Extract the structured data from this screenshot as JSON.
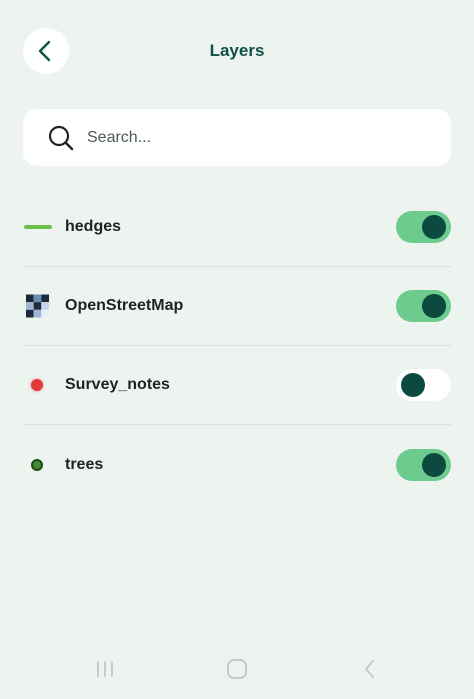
{
  "header": {
    "title": "Layers",
    "back_icon": "chevron-left-icon"
  },
  "search": {
    "placeholder": "Search...",
    "value": "",
    "icon": "search-icon"
  },
  "layers": [
    {
      "name": "hedges",
      "icon": "line-symbol-icon",
      "visible": true,
      "color": "#6CBF4B"
    },
    {
      "name": "OpenStreetMap",
      "icon": "raster-layer-icon",
      "visible": true
    },
    {
      "name": "Survey_notes",
      "icon": "point-symbol-icon",
      "visible": false,
      "color": "#E03A3A"
    },
    {
      "name": "trees",
      "icon": "point-symbol-icon",
      "visible": true,
      "color": "#3E8A2E"
    }
  ],
  "colors": {
    "background": "#EDF4F0",
    "accent": "#0E5146",
    "toggle_on": "#6DCB8E",
    "toggle_knob": "#0C4A40"
  },
  "navbar": {
    "recent_icon": "recent-apps-icon",
    "home_icon": "home-icon",
    "back_icon": "back-icon"
  }
}
